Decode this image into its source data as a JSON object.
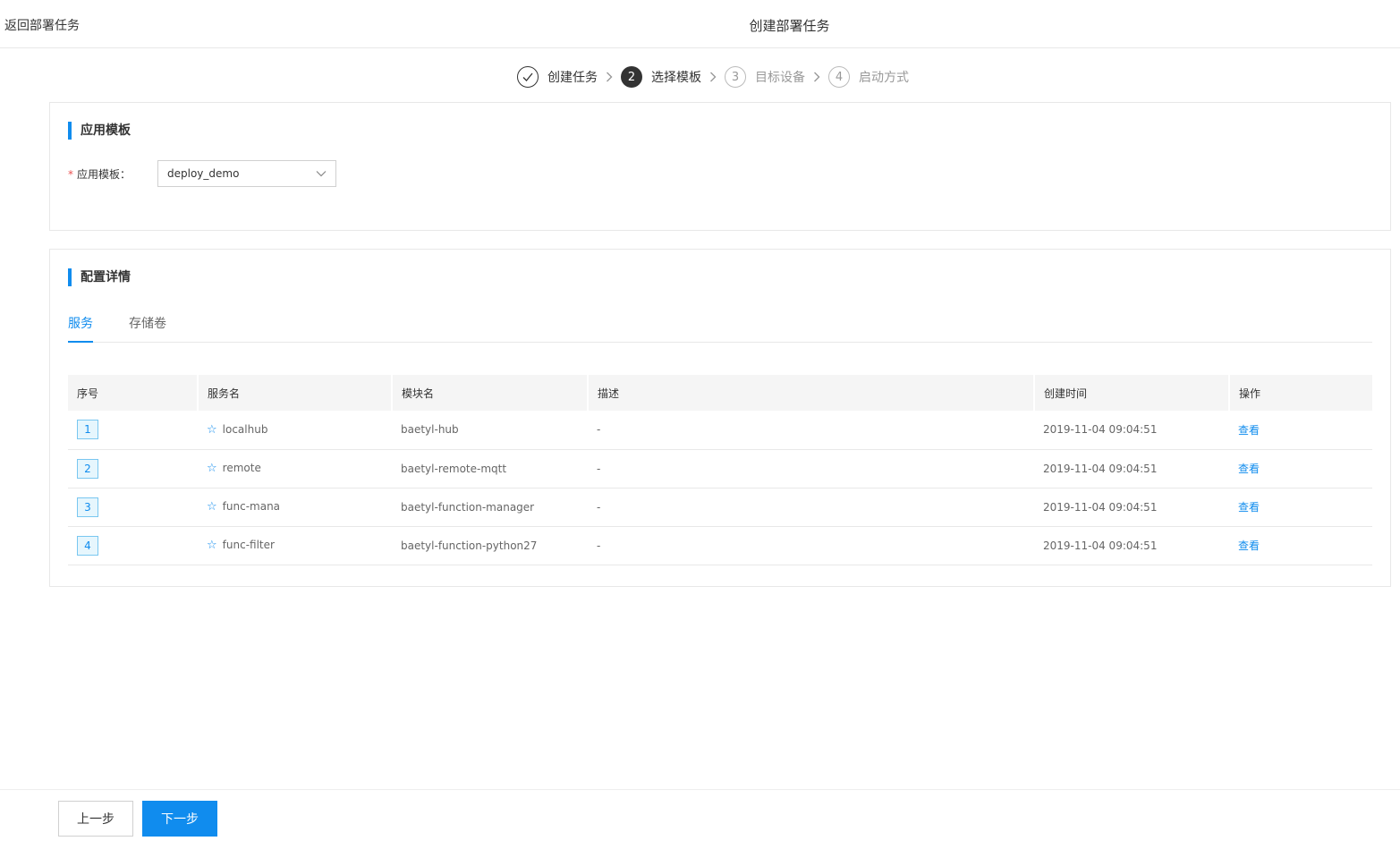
{
  "header": {
    "back_label": "返回部署任务",
    "title": "创建部署任务"
  },
  "steps": [
    {
      "number": "",
      "label": "创建任务",
      "state": "done"
    },
    {
      "number": "2",
      "label": "选择模板",
      "state": "active"
    },
    {
      "number": "3",
      "label": "目标设备",
      "state": "todo"
    },
    {
      "number": "4",
      "label": "启动方式",
      "state": "todo"
    }
  ],
  "template_section": {
    "title": "应用模板",
    "field_label": "应用模板：",
    "field_value": "deploy_demo"
  },
  "config_section": {
    "title": "配置详情",
    "tabs": [
      "服务",
      "存储卷"
    ],
    "columns": [
      "序号",
      "服务名",
      "模块名",
      "描述",
      "创建时间",
      "操作"
    ],
    "rows": [
      {
        "index": "1",
        "service": "localhub",
        "module": "baetyl-hub",
        "desc": "-",
        "created": "2019-11-04 09:04:51",
        "action": "查看"
      },
      {
        "index": "2",
        "service": "remote",
        "module": "baetyl-remote-mqtt",
        "desc": "-",
        "created": "2019-11-04 09:04:51",
        "action": "查看"
      },
      {
        "index": "3",
        "service": "func-mana",
        "module": "baetyl-function-manager",
        "desc": "-",
        "created": "2019-11-04 09:04:51",
        "action": "查看"
      },
      {
        "index": "4",
        "service": "func-filter",
        "module": "baetyl-function-python27",
        "desc": "-",
        "created": "2019-11-04 09:04:51",
        "action": "查看"
      }
    ]
  },
  "footer": {
    "prev_label": "上一步",
    "next_label": "下一步"
  },
  "colors": {
    "accent": "#108cee",
    "required": "#eb5252"
  }
}
